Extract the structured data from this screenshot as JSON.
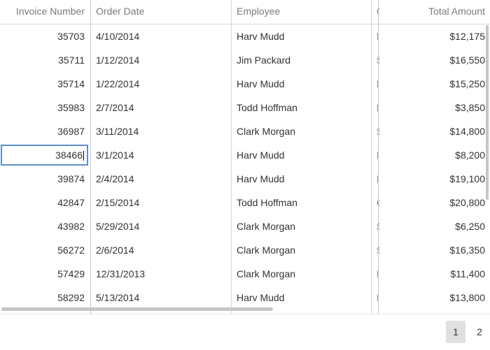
{
  "columns": {
    "invoice": "Invoice Number",
    "date": "Order Date",
    "employee": "Employee",
    "partial": "C",
    "total": "Total Amount"
  },
  "rows": [
    {
      "invoice": "35703",
      "date": "4/10/2014",
      "employee": "Harv Mudd",
      "c": "I",
      "total": "$12,175"
    },
    {
      "invoice": "35711",
      "date": "1/12/2014",
      "employee": "Jim Packard",
      "c": "S",
      "total": "$16,550"
    },
    {
      "invoice": "35714",
      "date": "1/22/2014",
      "employee": "Harv Mudd",
      "c": "I",
      "total": "$15,250"
    },
    {
      "invoice": "35983",
      "date": "2/7/2014",
      "employee": "Todd Hoffman",
      "c": "I",
      "total": "$3,850"
    },
    {
      "invoice": "36987",
      "date": "3/11/2014",
      "employee": "Clark Morgan",
      "c": "S",
      "total": "$14,800"
    },
    {
      "invoice": "38466",
      "date": "3/1/2014",
      "employee": "Harv Mudd",
      "c": "I",
      "total": "$8,200"
    },
    {
      "invoice": "39874",
      "date": "2/4/2014",
      "employee": "Harv Mudd",
      "c": "I",
      "total": "$19,100"
    },
    {
      "invoice": "42847",
      "date": "2/15/2014",
      "employee": "Todd Hoffman",
      "c": "C",
      "total": "$20,800"
    },
    {
      "invoice": "43982",
      "date": "5/29/2014",
      "employee": "Clark Morgan",
      "c": "S",
      "total": "$6,250"
    },
    {
      "invoice": "56272",
      "date": "2/6/2014",
      "employee": "Clark Morgan",
      "c": "S",
      "total": "$16,350"
    },
    {
      "invoice": "57429",
      "date": "12/31/2013",
      "employee": "Clark Morgan",
      "c": "I",
      "total": "$11,400"
    },
    {
      "invoice": "58292",
      "date": "5/13/2014",
      "employee": "Harv Mudd",
      "c": "I",
      "total": "$13,800"
    }
  ],
  "pager": {
    "pages": [
      "1",
      "2"
    ]
  },
  "colors": {
    "selection": "#5b8fc9",
    "active_page": "#e0e0e0",
    "grid_line": "#d8d8d8"
  }
}
